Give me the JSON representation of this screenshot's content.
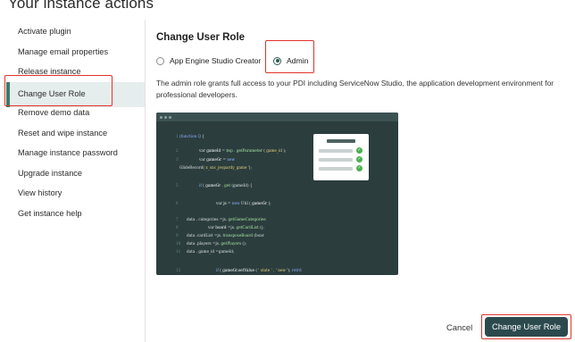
{
  "page": {
    "title": "Your instance actions"
  },
  "sidebar": {
    "items": [
      {
        "label": "Activate plugin"
      },
      {
        "label": "Manage email properties"
      },
      {
        "label": "Release instance"
      },
      {
        "label": "Change User Role",
        "active": true
      },
      {
        "label": "Remove demo data"
      },
      {
        "label": "Reset and wipe instance"
      },
      {
        "label": "Manage instance password"
      },
      {
        "label": "Upgrade instance"
      },
      {
        "label": "View history"
      },
      {
        "label": "Get instance help"
      }
    ]
  },
  "main": {
    "title": "Change User Role",
    "role_options": [
      {
        "label": "App Engine Studio Creator",
        "selected": false
      },
      {
        "label": "Admin",
        "selected": true
      }
    ],
    "description": "The admin role grants full access to your PDI including ServiceNow Studio, the application development environment for professional developers."
  },
  "preview": {
    "code": [
      {
        "n": "1",
        "parts": [
          [
            "kw",
            "(function"
          ],
          [
            "",
            "    "
          ],
          [
            "kw",
            "Q"
          ],
          [
            "",
            " {"
          ]
        ]
      },
      {
        "n": "2",
        "parts": [
          [
            "",
            "var "
          ],
          [
            "var",
            "gameId"
          ],
          [
            "",
            "    = "
          ],
          [
            "fn",
            "$sp . getParameter"
          ],
          [
            "",
            "   ("
          ],
          [
            "str",
            " game_id "
          ],
          [
            "",
            ");"
          ]
        ]
      },
      {
        "n": "3",
        "parts": [
          [
            "",
            "var "
          ],
          [
            "var",
            "gameGr"
          ],
          [
            "",
            "    = "
          ],
          [
            "kw",
            "new"
          ]
        ]
      },
      {
        "n": "",
        "parts": [
          [
            "",
            "GlideRecord("
          ],
          [
            "",
            "     "
          ],
          [
            "str",
            "x_snc_jeopardy_game"
          ],
          [
            "",
            "      ');"
          ]
        ]
      },
      {
        "n": "5",
        "parts": [
          [
            "kw",
            "if"
          ],
          [
            "",
            "  (    "
          ],
          [
            "var",
            "gameGr"
          ],
          [
            "",
            " . "
          ],
          [
            "fn",
            "get"
          ],
          [
            "",
            "  (gameId) {"
          ]
        ]
      },
      {
        "n": "6",
        "parts": [
          [
            "",
            "var "
          ],
          [
            "var",
            "js"
          ],
          [
            "",
            "      = "
          ],
          [
            "kw",
            "new"
          ],
          [
            "",
            "  Util     ( "
          ],
          [
            "var",
            "gameGr"
          ],
          [
            "",
            " );"
          ]
        ]
      },
      {
        "n": "7",
        "parts": [
          [
            "",
            "data"
          ],
          [
            "",
            "                    . categories       =js. "
          ],
          [
            "fn",
            "getGameCategories"
          ]
        ]
      },
      {
        "n": "8",
        "parts": [
          [
            "",
            "var "
          ],
          [
            "var",
            "board"
          ],
          [
            "",
            "   =js.  "
          ],
          [
            "fn",
            "getCardList"
          ],
          [
            "",
            "       ();"
          ]
        ]
      },
      {
        "n": "9",
        "parts": [
          [
            "",
            "data"
          ],
          [
            "",
            "                    .cardList          =js.   "
          ],
          [
            "fn",
            "transposeBoard"
          ],
          [
            "",
            "       (boar"
          ]
        ]
      },
      {
        "n": "10",
        "parts": [
          [
            "",
            "data"
          ],
          [
            "",
            "                    .players           =js.  "
          ],
          [
            "fn",
            "getPlayers"
          ],
          [
            "",
            "      ();"
          ]
        ]
      },
      {
        "n": "11",
        "parts": [
          [
            "",
            "data"
          ],
          [
            "",
            "                    . game_id      =gameId;"
          ]
        ]
      },
      {
        "n": "12",
        "parts": [
          [
            "kw",
            "if"
          ],
          [
            "",
            "   (  "
          ],
          [
            "var",
            "gameGr.setValue"
          ],
          [
            "",
            "      (  "
          ],
          [
            "str",
            "' state '"
          ],
          [
            "",
            "  , '"
          ],
          [
            "str",
            " new "
          ],
          [
            "",
            " ');   "
          ],
          [
            "kw",
            "retrd"
          ]
        ]
      }
    ]
  },
  "actions": {
    "cancel_label": "Cancel",
    "submit_label": "Change User Role"
  },
  "colors": {
    "accent": "#2c4a4e",
    "active_bar": "#3d7a68",
    "highlight": "#e0342b"
  },
  "icons": {
    "check": "check-icon"
  }
}
